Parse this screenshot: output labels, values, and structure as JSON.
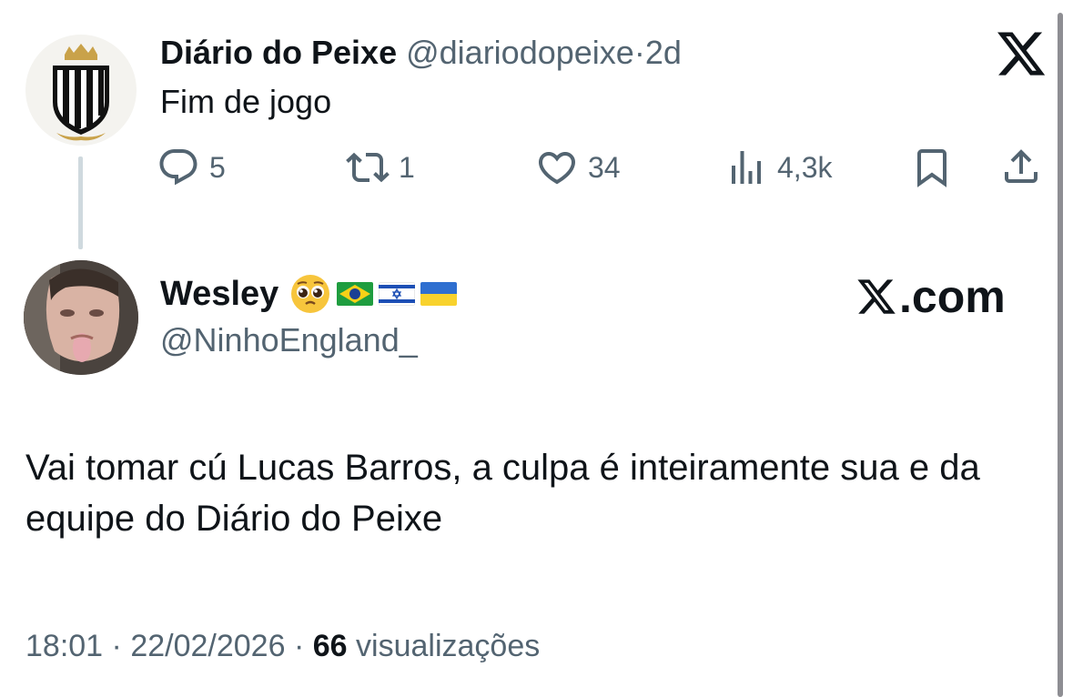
{
  "parent_tweet": {
    "name": "Diário do Peixe",
    "handle": "@diariodopeixe",
    "separator": "·",
    "time": "2d",
    "text": "Fim de jogo",
    "avatar_icon": "santos-crest-icon",
    "actions": {
      "replies": "5",
      "retweets": "1",
      "likes": "34",
      "views": "4,3k"
    }
  },
  "reply_tweet": {
    "name": "Wesley",
    "name_emoji": "pleading-face",
    "flags": [
      "brazil-flag",
      "israel-flag",
      "ukraine-flag"
    ],
    "handle": "@NinhoEngland_",
    "watermark": ".com",
    "text": "Vai tomar cú Lucas Barros, a culpa é inteiramente sua e da equipe do Diário do Peixe",
    "footer": {
      "time": "18:01",
      "sep1": "·",
      "date": "22/02/2026",
      "sep2": "·",
      "views_count": "66",
      "views_label": "visualizações"
    }
  },
  "colors": {
    "text": "#0f1419",
    "secondary": "#536471",
    "thread_line": "#cfd9de",
    "scrollbar": "#8e8e93"
  }
}
